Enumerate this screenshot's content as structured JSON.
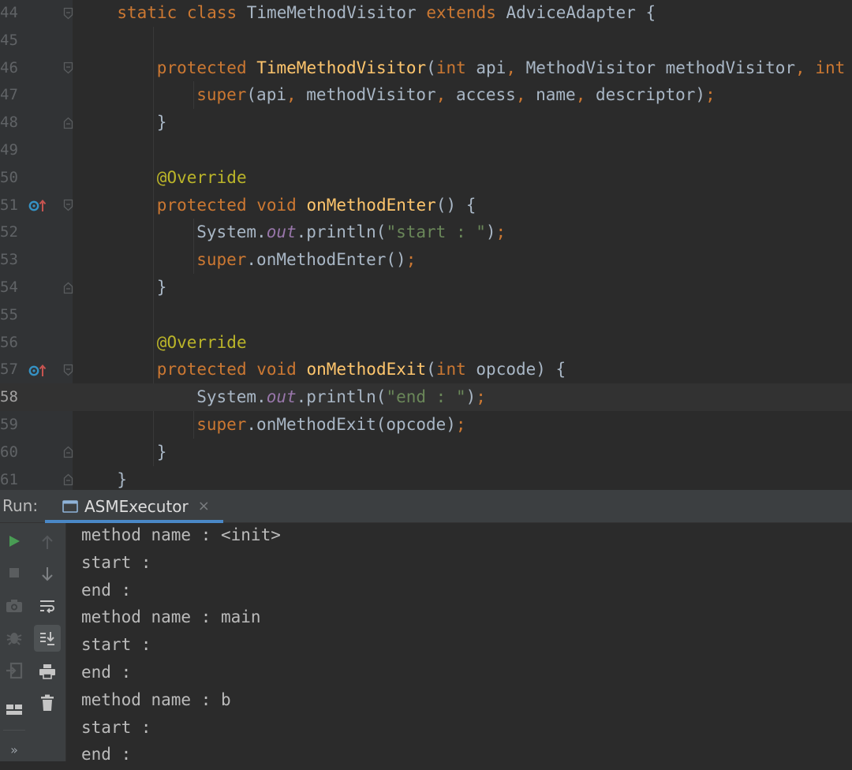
{
  "editor": {
    "lines": [
      {
        "num": "44",
        "fold": "open",
        "marker": false,
        "indent": 1,
        "tokens": [
          [
            "k",
            "static class "
          ],
          [
            "ty",
            "TimeMethodVisitor "
          ],
          [
            "k",
            "extends "
          ],
          [
            "ty",
            "AdviceAdapter {"
          ]
        ]
      },
      {
        "num": "45",
        "fold": "",
        "marker": false,
        "indent": 0,
        "tokens": []
      },
      {
        "num": "46",
        "fold": "open",
        "marker": false,
        "indent": 2,
        "tokens": [
          [
            "k",
            "protected "
          ],
          [
            "fn",
            "TimeMethodVisitor"
          ],
          [
            "ty",
            "("
          ],
          [
            "k",
            "int "
          ],
          [
            "ty",
            "api"
          ],
          [
            "k",
            ", "
          ],
          [
            "ty",
            "MethodVisitor methodVisitor"
          ],
          [
            "k",
            ", "
          ],
          [
            "k",
            "int"
          ]
        ]
      },
      {
        "num": "47",
        "fold": "",
        "marker": false,
        "indent": 3,
        "tokens": [
          [
            "k",
            "super"
          ],
          [
            "ty",
            "(api"
          ],
          [
            "k",
            ", "
          ],
          [
            "ty",
            "methodVisitor"
          ],
          [
            "k",
            ", "
          ],
          [
            "ty",
            "access"
          ],
          [
            "k",
            ", "
          ],
          [
            "ty",
            "name"
          ],
          [
            "k",
            ", "
          ],
          [
            "ty",
            "descriptor)"
          ],
          [
            "k",
            ";"
          ]
        ]
      },
      {
        "num": "48",
        "fold": "close",
        "marker": false,
        "indent": 2,
        "tokens": [
          [
            "ty",
            "}"
          ]
        ]
      },
      {
        "num": "49",
        "fold": "",
        "marker": false,
        "indent": 0,
        "tokens": []
      },
      {
        "num": "50",
        "fold": "",
        "marker": false,
        "indent": 2,
        "tokens": [
          [
            "an",
            "@Override"
          ]
        ]
      },
      {
        "num": "51",
        "fold": "open",
        "marker": true,
        "indent": 2,
        "tokens": [
          [
            "k",
            "protected void "
          ],
          [
            "fn",
            "onMethodEnter"
          ],
          [
            "ty",
            "() {"
          ]
        ]
      },
      {
        "num": "52",
        "fold": "",
        "marker": false,
        "indent": 3,
        "tokens": [
          [
            "ty",
            "System."
          ],
          [
            "it",
            "out"
          ],
          [
            "ty",
            ".println("
          ],
          [
            "st",
            "\"start : \""
          ],
          [
            "ty",
            ")"
          ],
          [
            "k",
            ";"
          ]
        ]
      },
      {
        "num": "53",
        "fold": "",
        "marker": false,
        "indent": 3,
        "tokens": [
          [
            "k",
            "super"
          ],
          [
            "ty",
            ".onMethodEnter()"
          ],
          [
            "k",
            ";"
          ]
        ]
      },
      {
        "num": "54",
        "fold": "close",
        "marker": false,
        "indent": 2,
        "tokens": [
          [
            "ty",
            "}"
          ]
        ]
      },
      {
        "num": "55",
        "fold": "",
        "marker": false,
        "indent": 0,
        "tokens": []
      },
      {
        "num": "56",
        "fold": "",
        "marker": false,
        "indent": 2,
        "tokens": [
          [
            "an",
            "@Override"
          ]
        ]
      },
      {
        "num": "57",
        "fold": "open",
        "marker": true,
        "indent": 2,
        "tokens": [
          [
            "k",
            "protected void "
          ],
          [
            "fn",
            "onMethodExit"
          ],
          [
            "ty",
            "("
          ],
          [
            "k",
            "int "
          ],
          [
            "ty",
            "opcode) {"
          ]
        ]
      },
      {
        "num": "58",
        "fold": "",
        "marker": false,
        "indent": 3,
        "current": true,
        "tokens": [
          [
            "ty",
            "System."
          ],
          [
            "it",
            "out"
          ],
          [
            "ty",
            ".println("
          ],
          [
            "st",
            "\"end : \""
          ],
          [
            "ty",
            ")"
          ],
          [
            "k",
            ";"
          ]
        ]
      },
      {
        "num": "59",
        "fold": "",
        "marker": false,
        "indent": 3,
        "tokens": [
          [
            "k",
            "super"
          ],
          [
            "ty",
            ".onMethodExit(opcode)"
          ],
          [
            "k",
            ";"
          ]
        ]
      },
      {
        "num": "60",
        "fold": "close",
        "marker": false,
        "indent": 2,
        "tokens": [
          [
            "ty",
            "}"
          ]
        ]
      },
      {
        "num": "61",
        "fold": "close",
        "marker": false,
        "indent": 1,
        "tokens": [
          [
            "ty",
            "}"
          ]
        ]
      }
    ]
  },
  "run_panel": {
    "label": "Run:",
    "tab_title": "ASMExecutor",
    "tab_close": "×",
    "output": [
      "method name : <init>",
      "start : ",
      "end : ",
      "method name : main",
      "start : ",
      "end : ",
      "method name : b",
      "start : ",
      "end : "
    ],
    "more_glyph": "»"
  },
  "colors": {
    "keyword": "#cc7832",
    "function": "#ffc66d",
    "annotation": "#bbb529",
    "string": "#6a8759",
    "field": "#9876aa",
    "text": "#a9b7c6",
    "accent": "#4a88c7",
    "run_green": "#499c54"
  }
}
